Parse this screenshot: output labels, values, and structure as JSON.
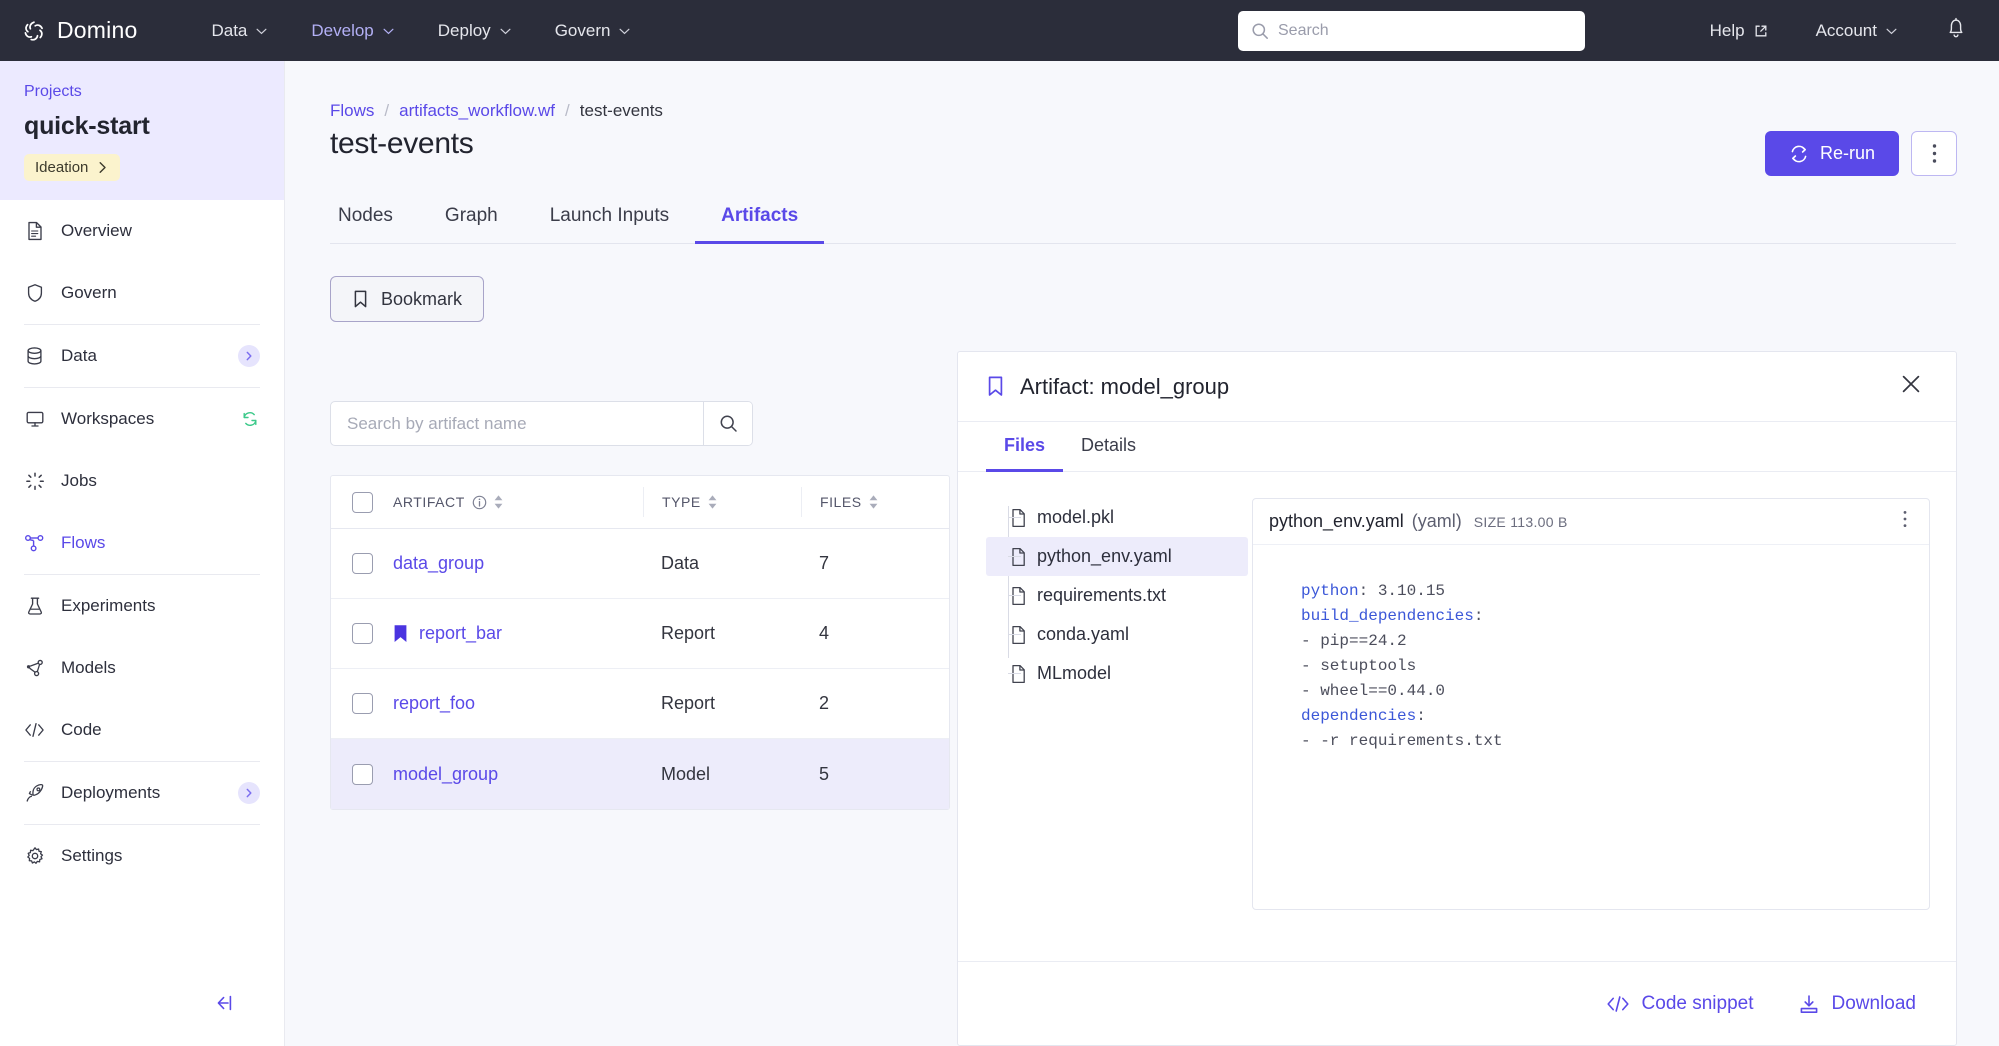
{
  "topnav": {
    "brand": "Domino",
    "menus": [
      {
        "label": "Data",
        "active": false
      },
      {
        "label": "Develop",
        "active": true
      },
      {
        "label": "Deploy",
        "active": false
      },
      {
        "label": "Govern",
        "active": false
      }
    ],
    "search_placeholder": "Search",
    "search_value": "",
    "help_label": "Help",
    "account_label": "Account"
  },
  "sidebar": {
    "projects_link": "Projects",
    "project_name": "quick-start",
    "stage_badge": "Ideation",
    "items": [
      {
        "label": "Overview",
        "icon": "document-icon",
        "active": false,
        "badge": false
      },
      {
        "label": "Govern",
        "icon": "shield-icon",
        "active": false,
        "badge": false
      },
      {
        "label": "Data",
        "icon": "database-icon",
        "active": false,
        "badge": true
      },
      {
        "label": "Workspaces",
        "icon": "monitor-icon",
        "active": false,
        "badge": false
      },
      {
        "label": "Jobs",
        "icon": "spinner-icon",
        "active": false,
        "badge": false
      },
      {
        "label": "Flows",
        "icon": "flow-icon",
        "active": true,
        "badge": false
      },
      {
        "label": "Experiments",
        "icon": "flask-icon",
        "active": false,
        "badge": false
      },
      {
        "label": "Models",
        "icon": "model-graph-icon",
        "active": false,
        "badge": false
      },
      {
        "label": "Code",
        "icon": "code-icon",
        "active": false,
        "badge": false
      },
      {
        "label": "Deployments",
        "icon": "rocket-icon",
        "active": false,
        "badge": true
      },
      {
        "label": "Settings",
        "icon": "gear-icon",
        "active": false,
        "badge": false
      }
    ]
  },
  "breadcrumb": {
    "item1": "Flows",
    "item2": "artifacts_workflow.wf",
    "item3": "test-events",
    "separator": "/"
  },
  "page": {
    "title": "test-events",
    "rerun_label": "Re-run",
    "tabs": [
      {
        "label": "Nodes",
        "active": false
      },
      {
        "label": "Graph",
        "active": false
      },
      {
        "label": "Launch Inputs",
        "active": false
      },
      {
        "label": "Artifacts",
        "active": true
      }
    ],
    "bookmark_label": "Bookmark"
  },
  "artifacts": {
    "search_placeholder": "Search by artifact name",
    "search_value": "",
    "columns": [
      "ARTIFACT",
      "TYPE",
      "FILES"
    ],
    "rows": [
      {
        "name": "data_group",
        "type": "Data",
        "files": "7",
        "bookmarked": false,
        "selected": false
      },
      {
        "name": "report_bar",
        "type": "Report",
        "files": "4",
        "bookmarked": true,
        "selected": false
      },
      {
        "name": "report_foo",
        "type": "Report",
        "files": "2",
        "bookmarked": false,
        "selected": false
      },
      {
        "name": "model_group",
        "type": "Model",
        "files": "5",
        "bookmarked": false,
        "selected": true
      }
    ]
  },
  "detail": {
    "title": "Artifact: model_group",
    "tabs": [
      {
        "label": "Files",
        "active": true
      },
      {
        "label": "Details",
        "active": false
      }
    ],
    "files": [
      {
        "name": "model.pkl",
        "selected": false
      },
      {
        "name": "python_env.yaml",
        "selected": true
      },
      {
        "name": "requirements.txt",
        "selected": false
      },
      {
        "name": "conda.yaml",
        "selected": false
      },
      {
        "name": "MLmodel",
        "selected": false
      }
    ],
    "preview": {
      "filename": "python_env.yaml",
      "filetype": "(yaml)",
      "size_label": "SIZE 113.00 B",
      "lines": [
        {
          "key": "python",
          "sep": ": ",
          "value": "3.10.15"
        },
        {
          "key": "build_dependencies",
          "sep": ":",
          "value": ""
        },
        {
          "key": "",
          "sep": "",
          "value": "- pip==24.2"
        },
        {
          "key": "",
          "sep": "",
          "value": "- setuptools"
        },
        {
          "key": "",
          "sep": "",
          "value": "- wheel==0.44.0"
        },
        {
          "key": "dependencies",
          "sep": ":",
          "value": ""
        },
        {
          "key": "",
          "sep": "",
          "value": "- -r requirements.txt"
        }
      ]
    },
    "code_snippet_label": "Code snippet",
    "download_label": "Download"
  },
  "colors": {
    "accent": "#5a49e8",
    "topnav_bg": "#2b2d3a",
    "project_header_bg": "#eceaff",
    "stage_badge_bg": "#fbf3cd",
    "row_selected_bg": "#edecfb",
    "page_bg": "#f7f8fc"
  }
}
